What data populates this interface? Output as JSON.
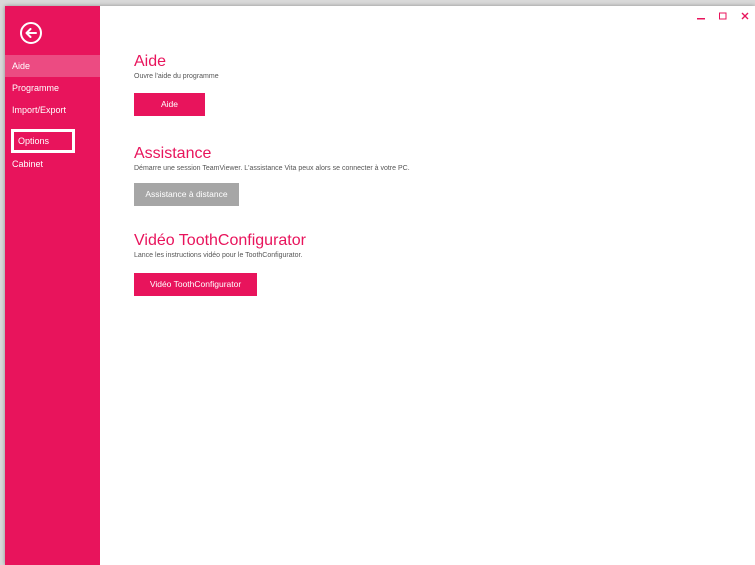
{
  "colors": {
    "accent": "#e8145c",
    "active_item": "#ec4b82",
    "disabled_button": "#a6a6a6"
  },
  "sidebar": {
    "back_icon": "arrow-left-circle-icon",
    "items": [
      {
        "label": "Aide",
        "active": true
      },
      {
        "label": "Programme"
      },
      {
        "label": "Import/Export"
      },
      {
        "label": "Options",
        "highlighted": true
      },
      {
        "label": "Cabinet"
      }
    ]
  },
  "window_controls": {
    "minimize_icon": "minimize-icon",
    "maximize_icon": "maximize-icon",
    "close_icon": "close-icon"
  },
  "sections": [
    {
      "title": "Aide",
      "description": "Ouvre l'aide du programme",
      "button_label": "Aide",
      "button_state": "enabled"
    },
    {
      "title": "Assistance",
      "description": "Démarre une session TeamViewer. L'assistance Vita peux alors se connecter à votre PC.",
      "button_label": "Assistance à distance",
      "button_state": "disabled"
    },
    {
      "title": "Vidéo ToothConfigurator",
      "description": "Lance les instructions vidéo pour le ToothConfigurator.",
      "button_label": "Vidéo ToothConfigurator",
      "button_state": "enabled"
    }
  ]
}
